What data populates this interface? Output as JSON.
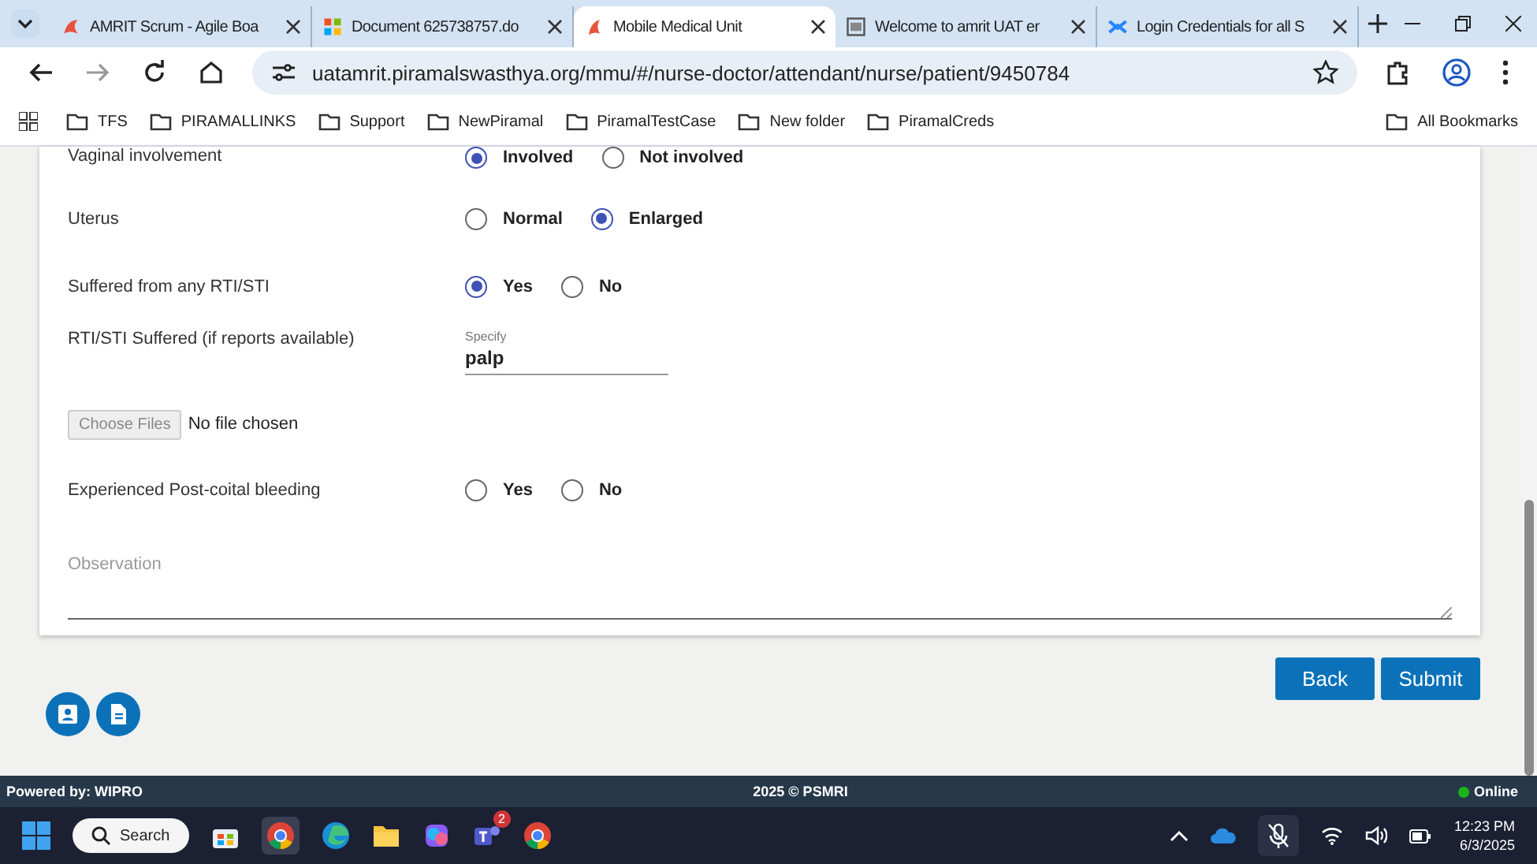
{
  "browser": {
    "tabs": [
      {
        "title": "AMRIT Scrum - Agile Boa",
        "selected": false
      },
      {
        "title": "Document 625738757.do",
        "selected": false
      },
      {
        "title": "Mobile Medical Unit",
        "selected": true
      },
      {
        "title": "Welcome to amrit UAT er",
        "selected": false
      },
      {
        "title": "Login Credentials for all S",
        "selected": false
      }
    ],
    "address": "uatamrit.piramalswasthya.org/mmu/#/nurse-doctor/attendant/nurse/patient/9450784",
    "bookmarks": [
      "TFS",
      "PIRAMALLINKS",
      "Support",
      "NewPiramal",
      "PiramalTestCase",
      "New folder",
      "PiramalCreds"
    ],
    "all_bookmarks": "All Bookmarks"
  },
  "form": {
    "rows": [
      {
        "kind": "radio",
        "label": "Vaginal involvement",
        "options": [
          {
            "label": "Involved",
            "selected": true
          },
          {
            "label": "Not involved",
            "selected": false
          }
        ]
      },
      {
        "kind": "radio",
        "label": "Uterus",
        "options": [
          {
            "label": "Normal",
            "selected": false
          },
          {
            "label": "Enlarged",
            "selected": true
          }
        ]
      },
      {
        "kind": "radio",
        "label": "Suffered from any RTI/STI",
        "options": [
          {
            "label": "Yes",
            "selected": true
          },
          {
            "label": "No",
            "selected": false
          }
        ]
      },
      {
        "kind": "text",
        "label": "RTI/STI Suffered (if reports available)",
        "field_label": "Specify",
        "value": "palp"
      },
      {
        "kind": "file",
        "button": "Choose Files",
        "status": "No file chosen"
      },
      {
        "kind": "radio",
        "label": "Experienced Post-coital bleeding",
        "options": [
          {
            "label": "Yes",
            "selected": false
          },
          {
            "label": "No",
            "selected": false
          }
        ]
      }
    ],
    "observation": {
      "placeholder": "Observation"
    }
  },
  "actions": [
    "Back",
    "Submit"
  ],
  "footer": {
    "powered_by": "Powered by: WIPRO",
    "copyright": "2025 © PSMRI",
    "status": "Online"
  },
  "taskbar": {
    "search": "Search",
    "badge": "2",
    "time": "12:23 PM",
    "date": "6/3/2025"
  }
}
